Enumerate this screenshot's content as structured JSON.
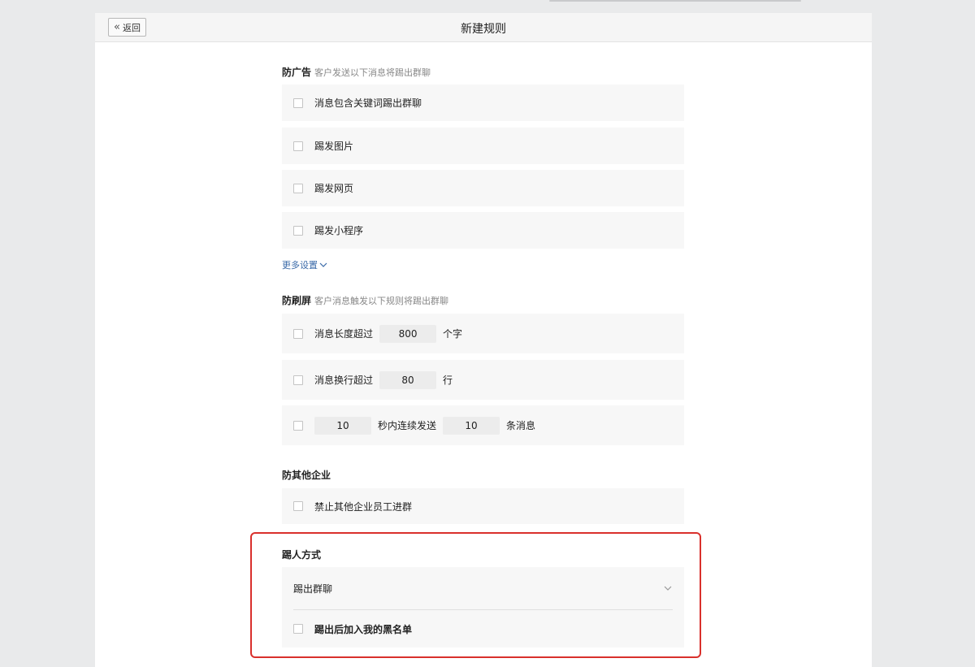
{
  "header": {
    "back_label": "返回",
    "title": "新建规则"
  },
  "anti_ad": {
    "title": "防广告",
    "subtitle": "客户发送以下消息将踢出群聊",
    "items": [
      {
        "label": "消息包含关键词踢出群聊"
      },
      {
        "label": "踢发图片"
      },
      {
        "label": "踢发网页"
      },
      {
        "label": "踢发小程序"
      }
    ],
    "more_label": "更多设置"
  },
  "anti_spam": {
    "title": "防刷屏",
    "subtitle": "客户消息触发以下规则将踢出群聊",
    "length": {
      "prefix": "消息长度超过",
      "value": "800",
      "suffix": "个字"
    },
    "lines": {
      "prefix": "消息换行超过",
      "value": "80",
      "suffix": "行"
    },
    "burst": {
      "seconds": "10",
      "middle": "秒内连续发送",
      "count": "10",
      "suffix": "条消息"
    }
  },
  "anti_other": {
    "title": "防其他企业",
    "items": [
      {
        "label": "禁止其他企业员工进群"
      }
    ]
  },
  "kick_mode": {
    "title": "踢人方式",
    "selected": "踢出群聊",
    "blacklist_label": "踢出后加入我的黑名单"
  },
  "colors": {
    "highlight": "#d9302c",
    "link": "#3a6aa8"
  }
}
